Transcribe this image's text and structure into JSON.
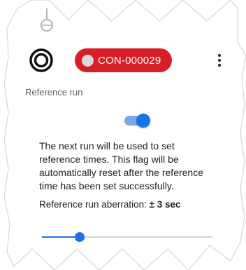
{
  "header": {
    "connection_id": "CON-000029",
    "chip_color": "#d81f26",
    "chip_dot_color": "#d9d9d9",
    "target_icon": "target-ring-icon",
    "more_icon": "more-vertical-icon"
  },
  "reference_run": {
    "label": "Reference run",
    "toggle_on": true,
    "description": "The next run will be used to set reference times. This flag will be automatically reset after the reference time has been set successfully.",
    "aberration_label": "Reference run aberration:",
    "aberration_value": "± 3 sec",
    "slider_fraction": 0.22,
    "accent_color": "#1a73e8"
  }
}
